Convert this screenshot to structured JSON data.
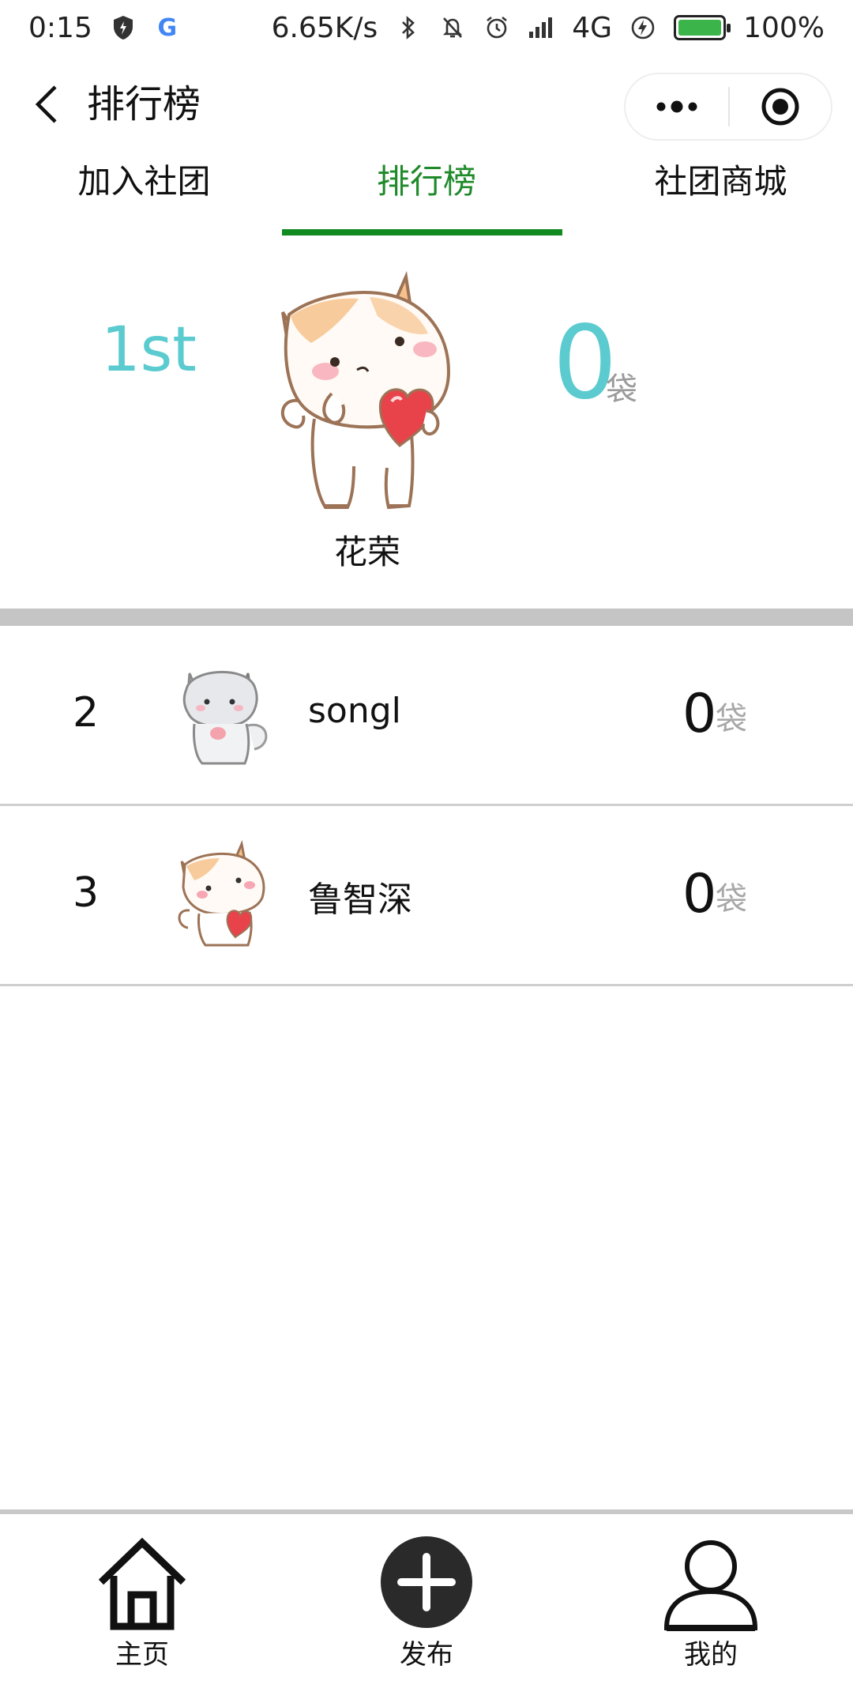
{
  "status_bar": {
    "time": "0:15",
    "network_speed": "6.65K/s",
    "network_type": "4G",
    "battery": "100%"
  },
  "header": {
    "title": "排行榜"
  },
  "tabs": [
    {
      "label": "加入社团",
      "active": false
    },
    {
      "label": "排行榜",
      "active": true
    },
    {
      "label": "社团商城",
      "active": false
    }
  ],
  "top_rank": {
    "rank": "1st",
    "name": "花荣",
    "score": "0",
    "unit": "袋"
  },
  "ranking": [
    {
      "rank": "2",
      "name": "songl",
      "score": "0",
      "unit": "袋",
      "avatar": "gray-cat"
    },
    {
      "rank": "3",
      "name": "鲁智深",
      "score": "0",
      "unit": "袋",
      "avatar": "orange-cat-heart"
    }
  ],
  "bottom_nav": [
    {
      "label": "主页",
      "icon": "home-icon"
    },
    {
      "label": "发布",
      "icon": "plus-circle-icon"
    },
    {
      "label": "我的",
      "icon": "user-icon"
    }
  ],
  "colors": {
    "active_tab": "#1f8a2a",
    "tab_indicator": "#118a1f",
    "accent_teal": "#5bcbd0",
    "unit_gray": "#9a9a9a"
  }
}
